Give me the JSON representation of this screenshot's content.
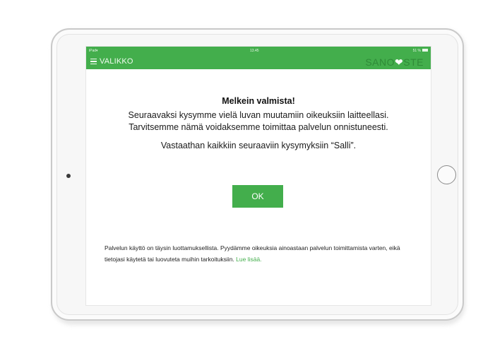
{
  "status_bar": {
    "device": "iPad",
    "wifi_icon": "wifi-icon",
    "time": "13.45",
    "battery_text": "51 %",
    "battery_icon": "battery-icon"
  },
  "nav": {
    "menu_label": "VALIKKO",
    "menu_icon": "hamburger-icon",
    "logo_left": "SANO",
    "logo_mark": "❤",
    "logo_right": "STE"
  },
  "dialog": {
    "title": "Melkein valmista!",
    "line1": "Seuraavaksi kysymme vielä luvan muutamiin oikeuksiin laitteellasi.",
    "line2": "Tarvitsemme nämä voidaksemme toimittaa palvelun onnistuneesti.",
    "line3": "Vastaathan kaikkiin seuraaviin kysymyksiin “Salli”.",
    "ok_label": "OK"
  },
  "footer": {
    "text": "Palvelun käyttö on täysin luottamuksellista. Pyydämme oikeuksia ainoastaan palvelun toimittamista varten, eikä tietojasi käytetä tai luovuteta muihin tarkoituksiin. ",
    "link": "Lue lisää."
  },
  "colors": {
    "accent": "#43ae4c",
    "logo_dark": "#2f8a37"
  }
}
